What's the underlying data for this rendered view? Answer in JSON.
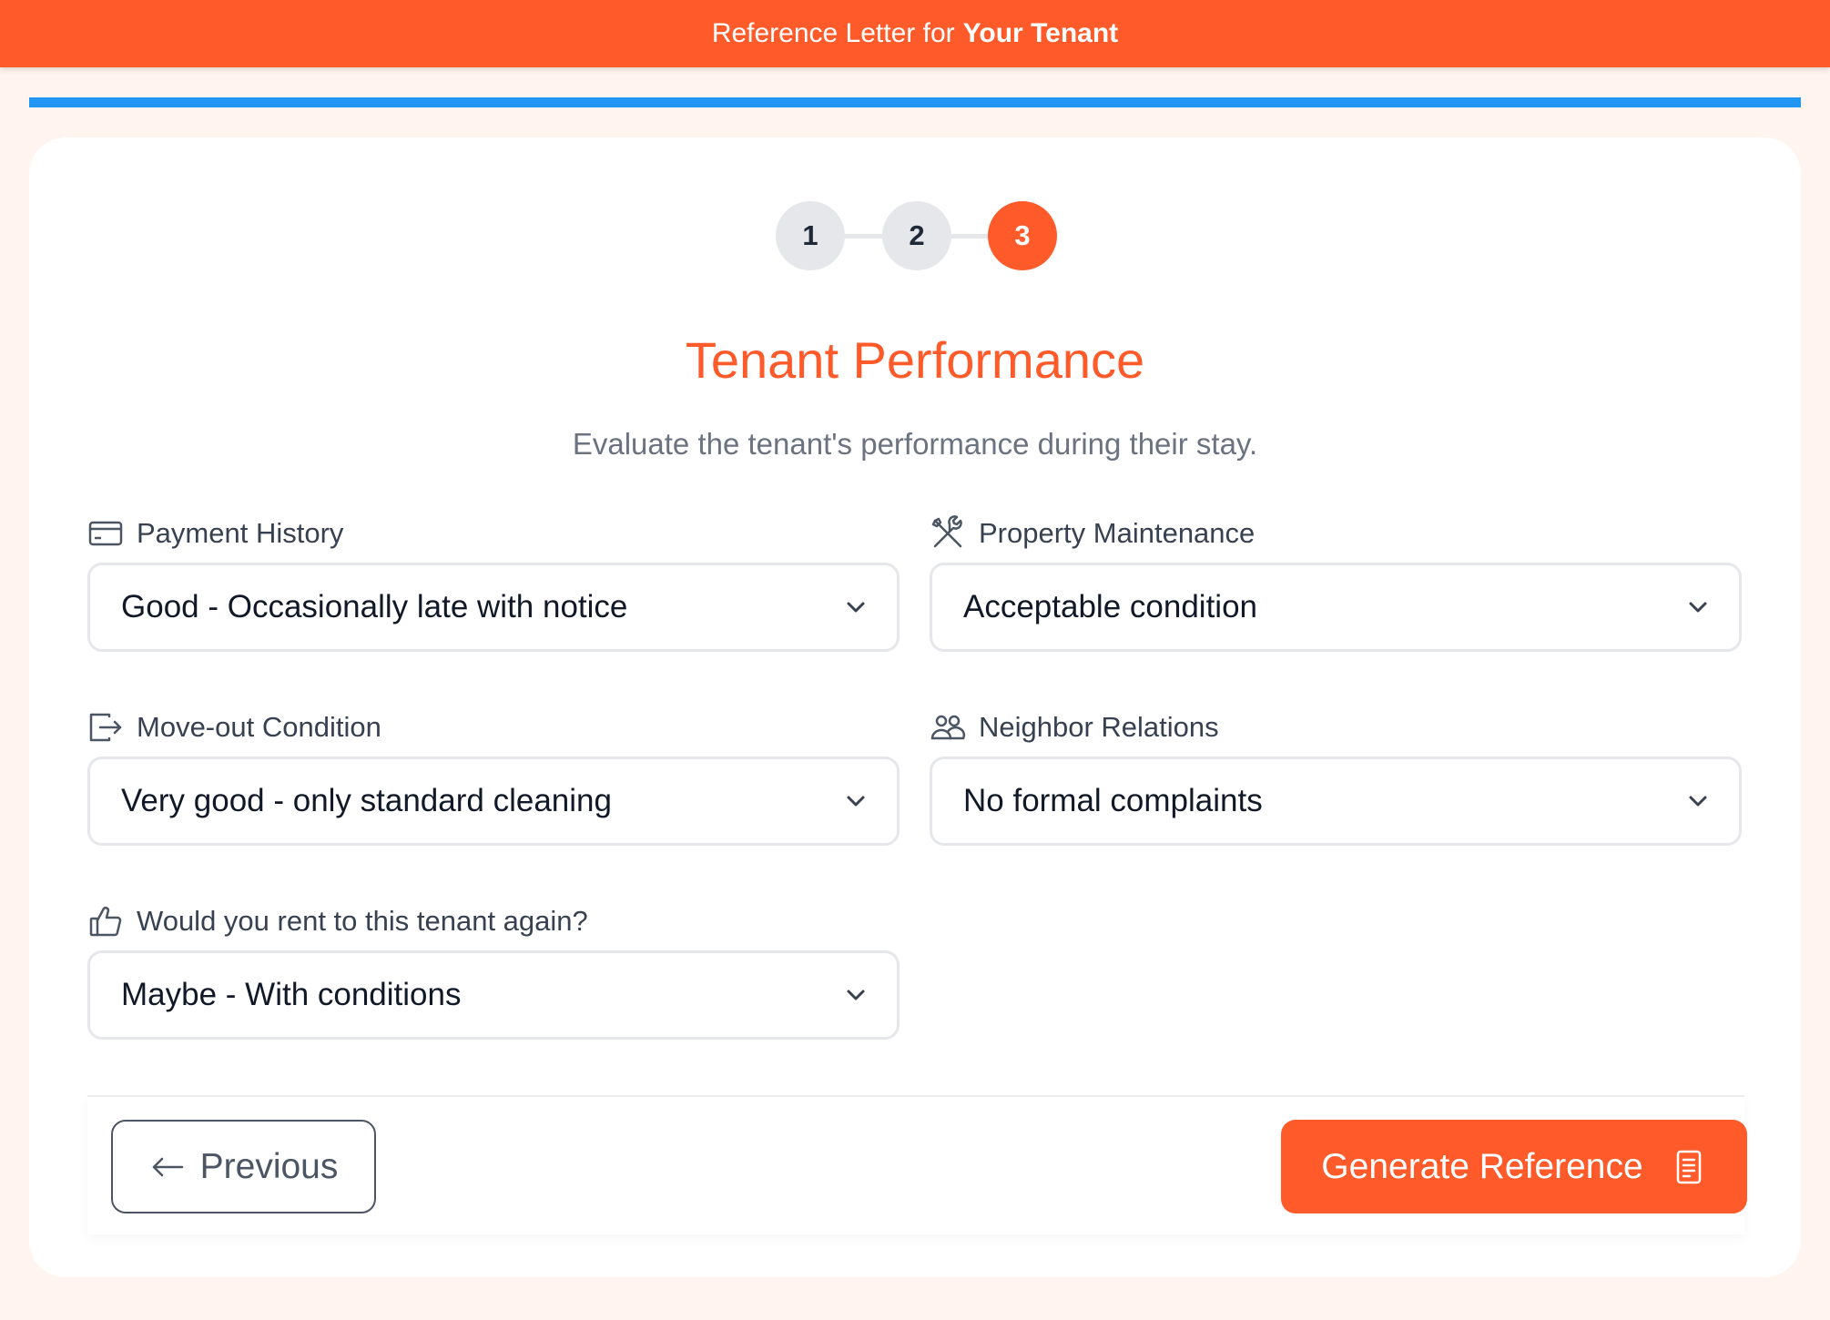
{
  "header": {
    "title_prefix": "Reference Letter for",
    "title_bold": "Your Tenant"
  },
  "progress": {
    "fraction": 1.0,
    "color": "#2196f3"
  },
  "stepper": {
    "steps": [
      {
        "label": "1",
        "active": false
      },
      {
        "label": "2",
        "active": false
      },
      {
        "label": "3",
        "active": true
      }
    ]
  },
  "section": {
    "title": "Tenant Performance",
    "subtitle": "Evaluate the tenant's performance during their stay."
  },
  "fields": {
    "payment": {
      "label": "Payment History",
      "icon": "credit-card-icon",
      "value": "Good - Occasionally late with notice"
    },
    "maintenance": {
      "label": "Property Maintenance",
      "icon": "tools-icon",
      "value": "Acceptable condition"
    },
    "moveout": {
      "label": "Move-out Condition",
      "icon": "exit-icon",
      "value": "Very good - only standard cleaning"
    },
    "neighbors": {
      "label": "Neighbor Relations",
      "icon": "people-icon",
      "value": "No formal complaints"
    },
    "rent_again": {
      "label": "Would you rent to this tenant again?",
      "icon": "thumbs-up-icon",
      "value": "Maybe - With conditions"
    }
  },
  "buttons": {
    "previous": "Previous",
    "generate": "Generate Reference"
  },
  "colors": {
    "accent": "#ff5a2a",
    "background": "#fff4ef",
    "progress": "#2196f3"
  }
}
